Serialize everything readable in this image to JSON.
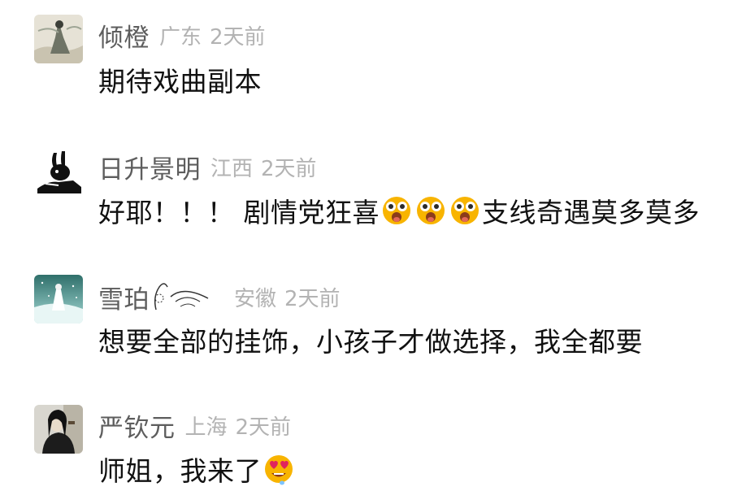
{
  "comments": [
    {
      "username": "倾橙",
      "location": "广东",
      "time": "2天前",
      "avatar_icon": "ink-painting-figure-avatar",
      "text": "期待戏曲副本"
    },
    {
      "username": "日升景明",
      "location": "江西",
      "time": "2天前",
      "avatar_icon": "black-white-rabbit-avatar",
      "text_before": "好耶！！！ 剧情党狂喜",
      "emojis": [
        "star-struck-face-emoji",
        "star-struck-face-emoji",
        "star-struck-face-emoji"
      ],
      "text_after": "支线奇遇莫多莫多"
    },
    {
      "username": "雪珀",
      "name_decoration_icon": "swirl-wind-decoration-icon",
      "location": "安徽",
      "time": "2天前",
      "avatar_icon": "snowy-scene-figure-avatar",
      "text": "想要全部的挂饰，小孩子才做选择，我全都要"
    },
    {
      "username": "严钦元",
      "location": "上海",
      "time": "2天前",
      "avatar_icon": "dark-robed-figure-avatar",
      "text_before": "师姐，我来了",
      "emojis": [
        "heart-eyes-face-emoji"
      ]
    }
  ]
}
